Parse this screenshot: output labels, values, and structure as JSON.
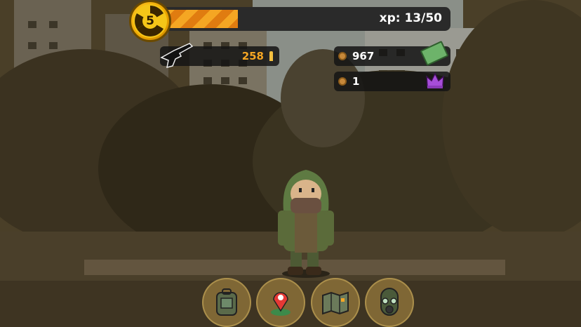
{
  "hud": {
    "level": "5",
    "xp_text": "xp: 13/50",
    "xp_progress": 0.26
  },
  "resources": {
    "ammo": "258",
    "coins": "967",
    "crowns": "1"
  },
  "icons": {
    "level": "radiation-icon",
    "weapon": "rifle-icon",
    "ammo": "bullet-icon",
    "coins": "coin-icon",
    "cash": "cash-icon",
    "crowns": "coin-icon",
    "premium": "crown-icon"
  },
  "bottom_menu": [
    {
      "icon": "backpack-icon"
    },
    {
      "icon": "map-pin-icon"
    },
    {
      "icon": "map-icon"
    },
    {
      "icon": "gas-mask-icon"
    }
  ],
  "colors": {
    "xp_fill": "#f5a623",
    "ammo_text": "#f5a623",
    "crown": "#a64dd8",
    "cash": "#6db36a"
  }
}
